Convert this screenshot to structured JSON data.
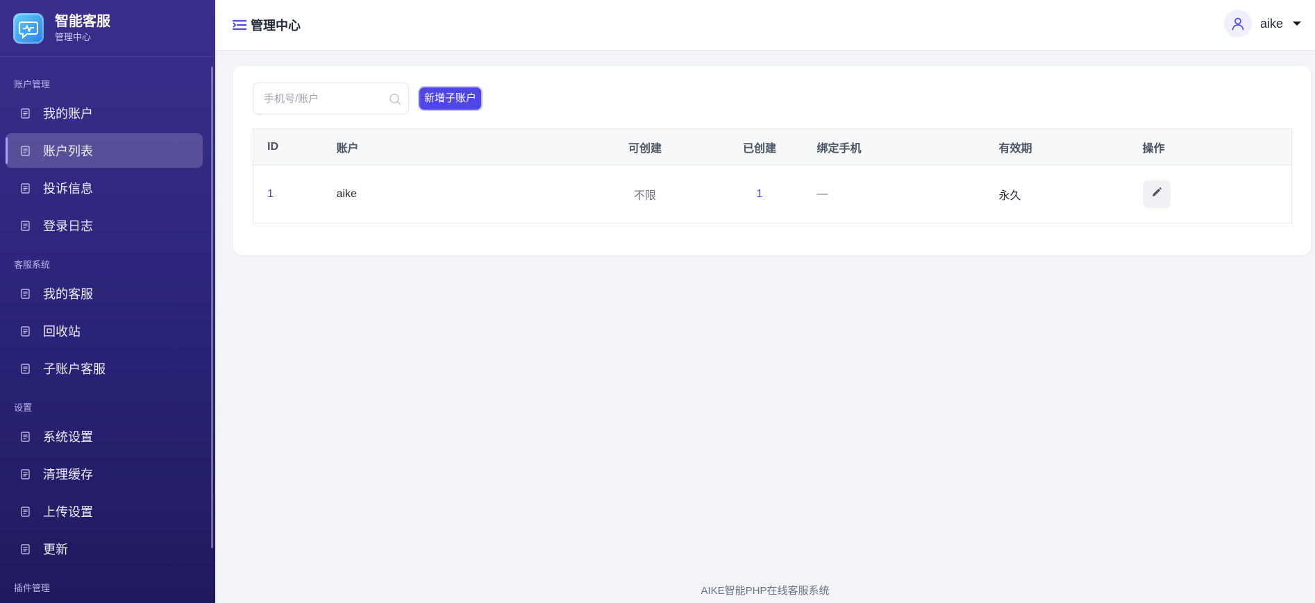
{
  "brand": {
    "title": "智能客服",
    "subtitle": "管理中心"
  },
  "nav": {
    "sections": [
      {
        "label": "账户管理",
        "items": [
          "我的账户",
          "账户列表",
          "投诉信息",
          "登录日志"
        ]
      },
      {
        "label": "客服系统",
        "items": [
          "我的客服",
          "回收站",
          "子账户客服"
        ]
      },
      {
        "label": "设置",
        "items": [
          "系统设置",
          "清理缓存",
          "上传设置",
          "更新"
        ]
      },
      {
        "label": "插件管理",
        "items": []
      }
    ],
    "active_item": "账户列表"
  },
  "header": {
    "title": "管理中心",
    "username": "aike"
  },
  "toolbar": {
    "search_placeholder": "手机号/账户",
    "add_button": "新增子账户"
  },
  "table": {
    "columns": [
      "ID",
      "账户",
      "可创建",
      "已创建",
      "绑定手机",
      "有效期",
      "操作"
    ],
    "rows": [
      {
        "id": "1",
        "account": "aike",
        "can_create": "不限",
        "created": "1",
        "phone": "—",
        "expiry": "永久"
      }
    ]
  },
  "footer": {
    "text": "AIKE智能PHP在线客服系统"
  },
  "colors": {
    "accent": "#4f46e5",
    "sidebar_top": "#3a2f8c",
    "sidebar_bottom": "#1f1a5c"
  },
  "icons": {
    "brand": "chat-pulse-icon",
    "nav": "document-icon",
    "menu": "menu-toggle-icon",
    "user": "user-icon",
    "search": "search-icon",
    "edit": "pencil-icon"
  }
}
